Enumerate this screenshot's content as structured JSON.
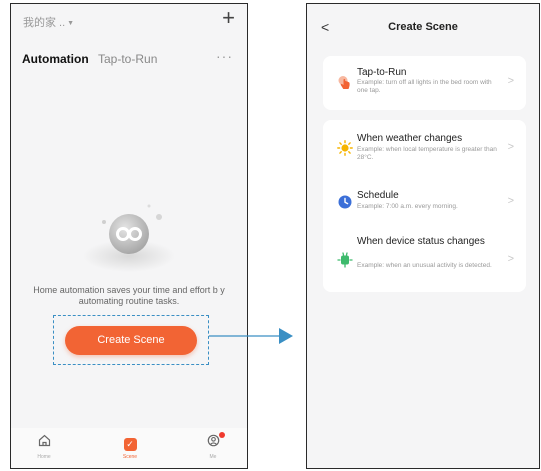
{
  "left_screen": {
    "home_selector": "我的家 ..",
    "tabs": {
      "active": "Automation",
      "inactive": "Tap-to-Run"
    },
    "more_label": "···",
    "empty_text": "Home automation saves your time and effort b y automating routine tasks.",
    "create_button": "Create Scene",
    "nav": {
      "home": "Home",
      "scene": "Scene",
      "me": "Me"
    }
  },
  "right_screen": {
    "back": "<",
    "title": "Create Scene",
    "items": [
      {
        "title": "Tap-to-Run",
        "desc": "Example: turn off all lights in the bed room with one tap."
      },
      {
        "title": "When weather changes",
        "desc": "Example: when local temperature is greater than 28°C."
      },
      {
        "title": "Schedule",
        "desc": "Example: 7:00 a.m. every morning."
      },
      {
        "title": "When device status changes",
        "desc": "Example: when an unusual activity is detected."
      }
    ]
  },
  "colors": {
    "accent": "#f26434",
    "highlight": "#3a8fc4",
    "weather": "#f6b400",
    "schedule": "#3b6fd8",
    "device": "#3dba6c"
  },
  "icons": [
    "plus-icon",
    "more-icon",
    "link-icon",
    "home-icon",
    "scene-icon",
    "me-icon",
    "back-icon",
    "hand-tap-icon",
    "sun-icon",
    "clock-icon",
    "device-icon",
    "chevron-right-icon"
  ]
}
